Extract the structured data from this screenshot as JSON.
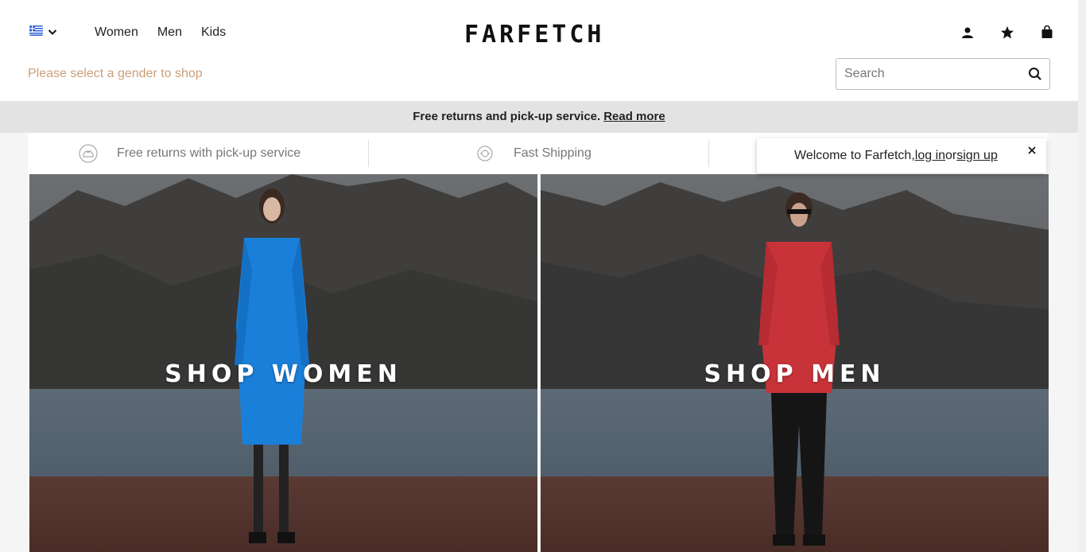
{
  "header": {
    "country_flag": "greece-flag",
    "nav": [
      "Women",
      "Men",
      "Kids"
    ],
    "logo": "FARFETCH",
    "gender_hint": "Please select a gender to shop",
    "search_placeholder": "Search",
    "icons": [
      "account-icon",
      "wishlist-star-icon",
      "shopping-bag-icon",
      "search-icon"
    ]
  },
  "promo": {
    "text": "Free returns and pick-up service.",
    "link": "Read more"
  },
  "features": [
    {
      "label": "Free returns with pick-up service",
      "icon": "returns-icon"
    },
    {
      "label": "Fast Shipping",
      "icon": "shipping-icon"
    }
  ],
  "welcome": {
    "prefix": "Welcome to Farfetch, ",
    "login": "log in ",
    "middle": "or ",
    "signup": "sign up"
  },
  "heroes": {
    "women": "SHOP WOMEN",
    "men": "SHOP MEN"
  },
  "colors": {
    "accent_hint": "#caa07a",
    "promo_bg": "#e3e3e3",
    "page_bg": "#f5f5f5"
  }
}
